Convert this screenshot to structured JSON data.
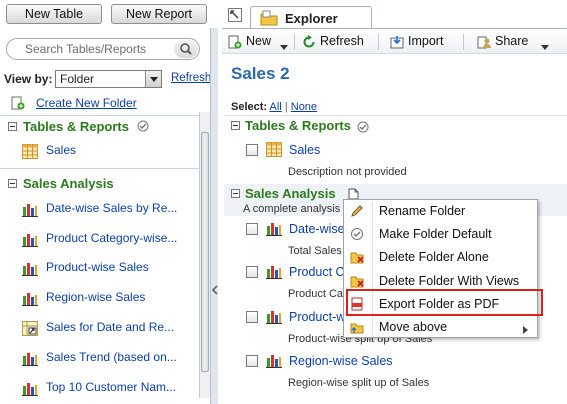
{
  "top_buttons": {
    "new_table": "New Table",
    "new_report": "New Report"
  },
  "left": {
    "search_placeholder": "Search Tables/Reports",
    "view_by_label": "View by:",
    "view_by_value": "Folder",
    "refresh": "Refresh",
    "create_folder": "Create New Folder",
    "sections": [
      {
        "title": "Tables & Reports",
        "items": [
          "Sales"
        ]
      },
      {
        "title": "Sales Analysis",
        "items": [
          "Date-wise Sales by Re...",
          "Product Category-wise...",
          "Product-wise Sales",
          "Region-wise Sales",
          "Sales for Date and Re...",
          "Sales Trend (based on...",
          "Top 10 Customer Nam..."
        ]
      }
    ]
  },
  "tab": {
    "label": "Explorer"
  },
  "toolbar": {
    "new": "New",
    "refresh": "Refresh",
    "import": "Import",
    "share": "Share"
  },
  "main": {
    "title": "Sales 2",
    "select_label": "Select:",
    "select_all": "All",
    "select_sep": "|",
    "select_none": "None",
    "section1": {
      "title": "Tables & Reports",
      "item": "Sales",
      "desc": "Description not provided"
    },
    "section2": {
      "title": "Sales Analysis",
      "desc": "A complete analysis o",
      "rows": [
        {
          "name": "Date-wise S",
          "desc": "Total Sales a"
        },
        {
          "name": "Product Cat",
          "desc": "Product Cate"
        },
        {
          "name": "Product-wis",
          "desc": "Product-wise split up of Sales"
        },
        {
          "name": "Region-wise Sales",
          "desc": "Region-wise split up of Sales"
        }
      ]
    }
  },
  "menu": {
    "items": [
      "Rename Folder",
      "Make Folder Default",
      "Delete Folder Alone",
      "Delete Folder With Views",
      "Export Folder as PDF",
      "Move above"
    ]
  },
  "colors": {
    "accent_green": "#2b7a1d",
    "link_blue": "#0b3fa8",
    "highlight_red": "#e0201b"
  }
}
